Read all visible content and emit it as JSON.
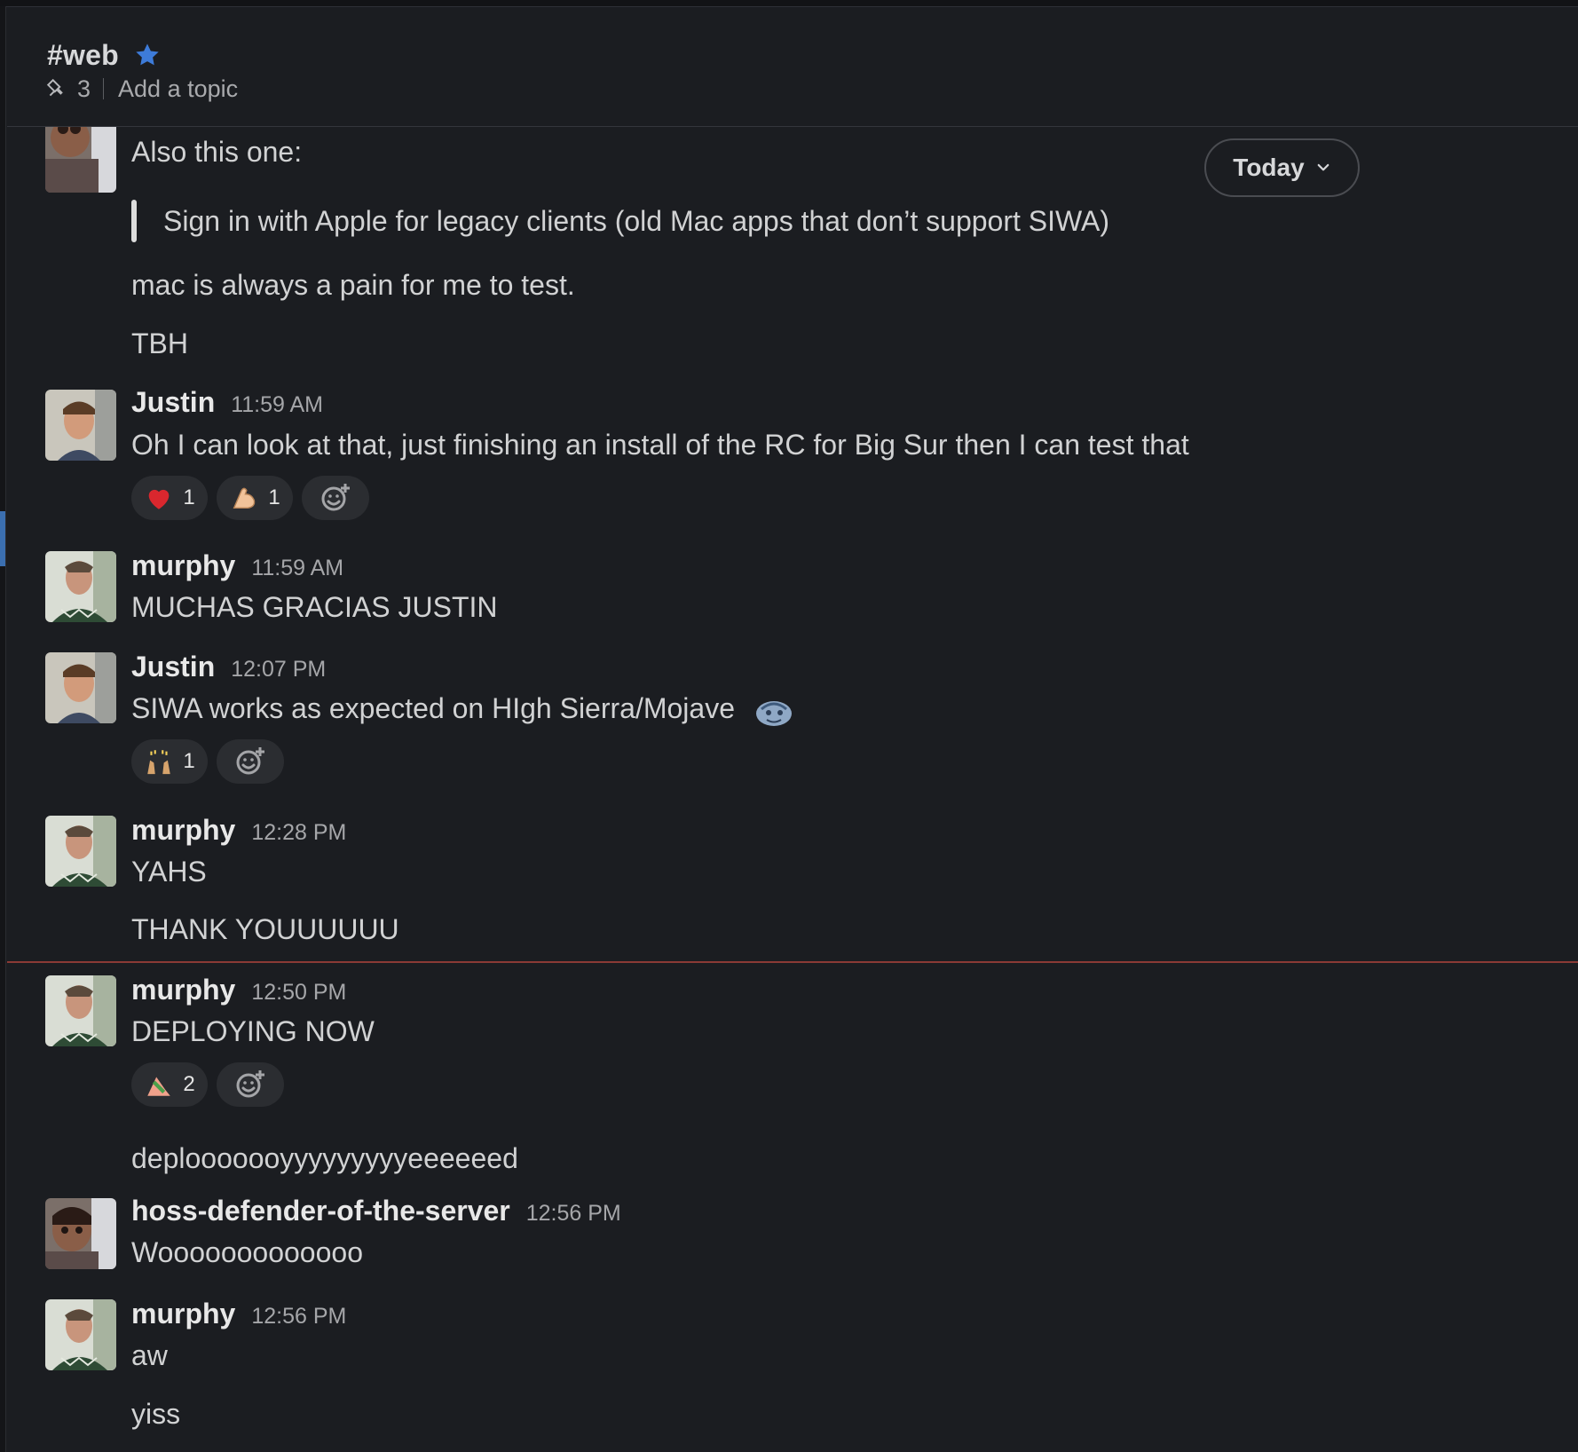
{
  "channel": {
    "name": "#web",
    "pinned_count": "3",
    "topic_placeholder": "Add a topic"
  },
  "date_pill": {
    "label": "Today"
  },
  "messages": [
    {
      "text_1": "Also this one:",
      "quote": "Sign in with Apple for legacy clients (old Mac apps that don’t support SIWA)",
      "text_2": "mac is always a pain for me to test.",
      "text_3": "TBH"
    },
    {
      "author": "Justin",
      "time": "11:59 AM",
      "text": "Oh I can look at that, just finishing an install of the RC for Big Sur then I can test that",
      "reactions": [
        {
          "emoji": "heart",
          "count": "1"
        },
        {
          "emoji": "flexed-biceps",
          "count": "1"
        }
      ]
    },
    {
      "author": "murphy",
      "time": "11:59 AM",
      "text": "MUCHAS GRACIAS JUSTIN"
    },
    {
      "author": "Justin",
      "time": "12:07 PM",
      "text": "SIWA works as expected on HIgh Sierra/Mojave",
      "reactions": [
        {
          "emoji": "raised-hands",
          "count": "1"
        }
      ]
    },
    {
      "author": "murphy",
      "time": "12:28 PM",
      "text_1": "YAHS",
      "text_2": "THANK YOUUUUUU"
    },
    {
      "author": "murphy",
      "time": "12:50 PM",
      "text_1": "DEPLOYING NOW",
      "reactions": [
        {
          "emoji": "rocket-slide",
          "count": "2"
        }
      ],
      "text_2": "deplooooooyyyyyyyyyeeeeeed"
    },
    {
      "author": "hoss-defender-of-the-server",
      "time": "12:56 PM",
      "text": "Wooooooooooooo"
    },
    {
      "author": "murphy",
      "time": "12:56 PM",
      "text_1": "aw",
      "text_2": "yiss"
    }
  ]
}
